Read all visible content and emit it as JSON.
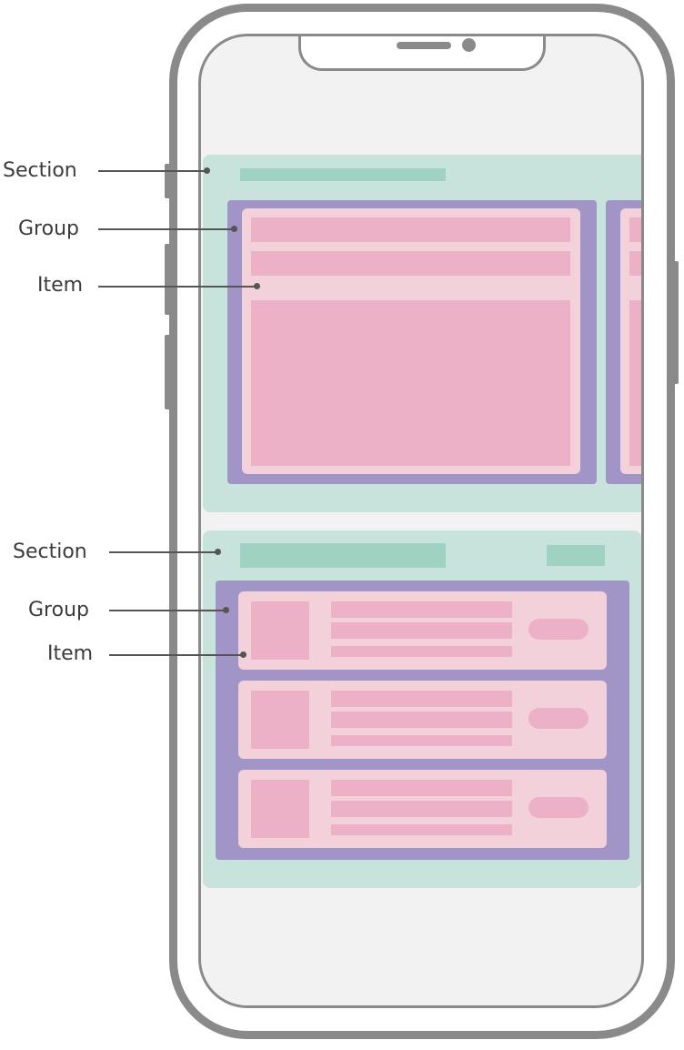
{
  "labels": {
    "section_1": "Section",
    "group_1": "Group",
    "item_1": "Item",
    "section_2": "Section",
    "group_2": "Group",
    "item_2": "Item"
  },
  "colors": {
    "phone_frame": "#8a8a8a",
    "screen": "#f2f2f2",
    "section": "#c8e3dc",
    "section_title": "#a0d2c2",
    "group": "#a194c6",
    "item": "#f3d1da",
    "item_content": "#ecb1c6",
    "leader": "#555555"
  }
}
